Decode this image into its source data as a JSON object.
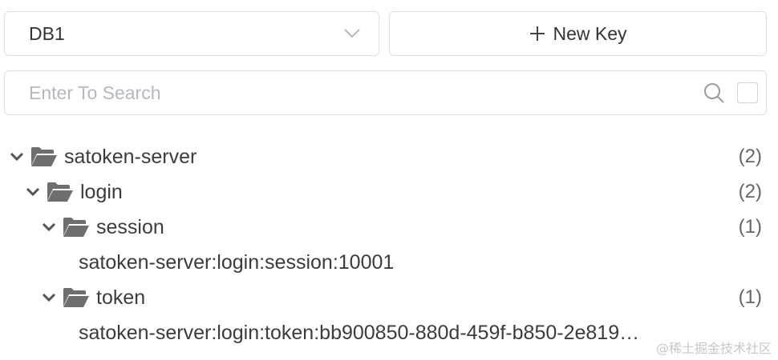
{
  "toolbar": {
    "db_select_value": "DB1",
    "new_key_label": "New Key"
  },
  "search": {
    "placeholder": "Enter To Search"
  },
  "tree": {
    "root": {
      "label": "satoken-server",
      "count": "(2)"
    },
    "login": {
      "label": "login",
      "count": "(2)"
    },
    "session": {
      "label": "session",
      "count": "(1)"
    },
    "session_key": {
      "label": "satoken-server:login:session:10001"
    },
    "token": {
      "label": "token",
      "count": "(1)"
    },
    "token_key": {
      "label": "satoken-server:login:token:bb900850-880d-459f-b850-2e819…"
    }
  },
  "watermark": "@稀土掘金技术社区",
  "colors": {
    "border": "#dcdfe6",
    "icon": "#6e6e6e",
    "text": "#3c3c3c",
    "placeholder": "#b5b8be"
  },
  "icons": [
    "chevron-down-icon",
    "plus-icon",
    "search-icon",
    "caret-down-icon",
    "folder-open-icon"
  ]
}
